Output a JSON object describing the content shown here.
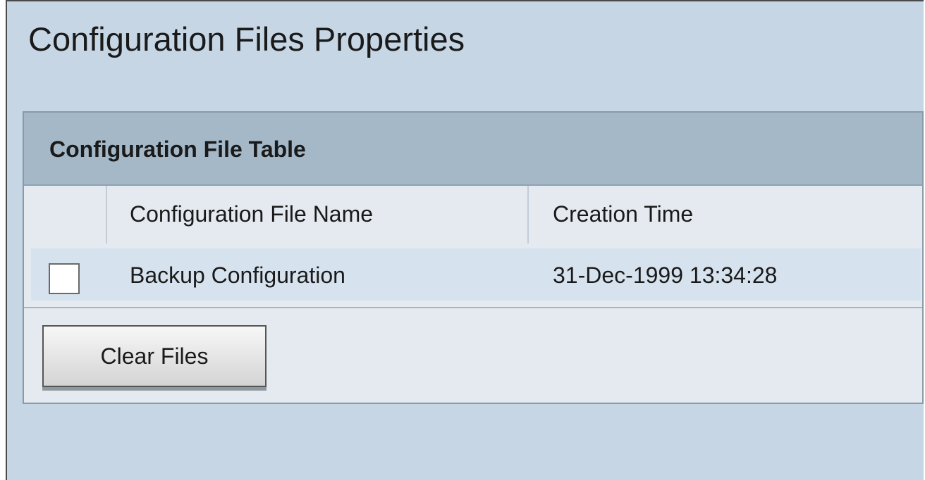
{
  "page": {
    "title": "Configuration Files Properties"
  },
  "table": {
    "title": "Configuration File Table",
    "columns": [
      "",
      "Configuration File Name",
      "Creation Time"
    ],
    "rows": [
      {
        "checked": false,
        "name": "Backup Configuration",
        "creation_time": "31-Dec-1999 13:34:28"
      }
    ]
  },
  "actions": {
    "clear_files_label": "Clear Files"
  },
  "colors": {
    "page_background": "#c6d6e5",
    "table_header_background": "#a4b8c8",
    "table_background": "#e4eaf0",
    "row_background": "#d6e2ee"
  }
}
